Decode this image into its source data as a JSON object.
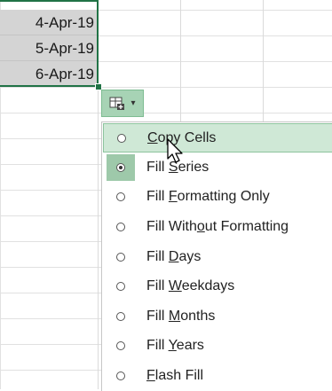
{
  "cells": [
    {
      "value": "4-Apr-19"
    },
    {
      "value": "5-Apr-19"
    },
    {
      "value": "6-Apr-19"
    }
  ],
  "autofill_button": {
    "icon": "auto-fill-options-icon",
    "dropdown_icon": "chevron-down-icon"
  },
  "menu": {
    "selected": "Fill Series",
    "hovered": "Copy Cells",
    "items": [
      {
        "pre": "",
        "key": "C",
        "post": "opy Cells"
      },
      {
        "pre": "Fill ",
        "key": "S",
        "post": "eries"
      },
      {
        "pre": "Fill ",
        "key": "F",
        "post": "ormatting Only"
      },
      {
        "pre": "Fill With",
        "key": "o",
        "post": "ut Formatting"
      },
      {
        "pre": "Fill ",
        "key": "D",
        "post": "ays"
      },
      {
        "pre": "Fill ",
        "key": "W",
        "post": "eekdays"
      },
      {
        "pre": "Fill ",
        "key": "M",
        "post": "onths"
      },
      {
        "pre": "Fill ",
        "key": "Y",
        "post": "ears"
      },
      {
        "pre": "",
        "key": "F",
        "post": "lash Fill"
      }
    ]
  },
  "colors": {
    "selection_border": "#217346",
    "selected_cell_fill": "#d4d4d4",
    "menu_hover": "#cfe8d6",
    "radio_checked_bg": "#9ec9aa"
  }
}
